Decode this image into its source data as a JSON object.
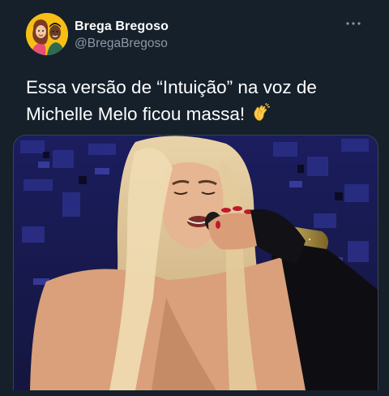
{
  "tweet": {
    "display_name": "Brega Bregoso",
    "handle": "@BregaBregoso",
    "text": "Essa versão de “Intuição” na voz de Michelle Melo ficou massa!",
    "emoji": "clapping-hands-emoji"
  },
  "icons": {
    "avatar": "avatar-illustration",
    "more": "more-options-icon"
  },
  "colors": {
    "background": "#15202b",
    "secondary_text": "#8b98a5",
    "primary_text": "#ffffff",
    "border": "#38444d"
  }
}
